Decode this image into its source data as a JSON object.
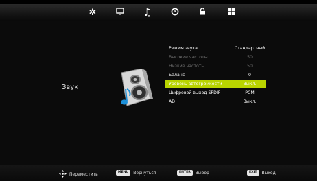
{
  "tabs": [
    {
      "name": "picture-icon",
      "glyph": "✲"
    },
    {
      "name": "monitor-icon",
      "glyph": "🖵"
    },
    {
      "name": "music-note-icon",
      "glyph": "♫"
    },
    {
      "name": "clock-icon",
      "glyph": "⊙"
    },
    {
      "name": "lock-icon",
      "glyph": "🔒"
    },
    {
      "name": "grid-icon",
      "glyph": "▦"
    }
  ],
  "category": "Звук",
  "menu": [
    {
      "label": "Режим звука",
      "value": "Стандартный",
      "state": "normal"
    },
    {
      "label": "Высокие частоты",
      "value": "50",
      "state": "disabled"
    },
    {
      "label": "Низкие частоты",
      "value": "50",
      "state": "disabled"
    },
    {
      "label": "Баланс",
      "value": "0",
      "state": "normal"
    },
    {
      "label": "Уровень автогромкости",
      "value": "Выкл.",
      "state": "selected"
    },
    {
      "label": "Цифровой выход SPDIF",
      "value": "PCM",
      "state": "normal"
    },
    {
      "label": "AD",
      "value": "Выкл.",
      "state": "normal"
    }
  ],
  "hints": {
    "move": "Переместить",
    "menu_key": "MENU",
    "back": "Вернуться",
    "enter_key": "ENTER",
    "select": "Выбор",
    "exit_key": "EXIT",
    "exit": "Выход"
  },
  "colors": {
    "highlight": "#b9d400",
    "disabled": "#6e6e6e",
    "speaker": "#1c8fd8"
  }
}
